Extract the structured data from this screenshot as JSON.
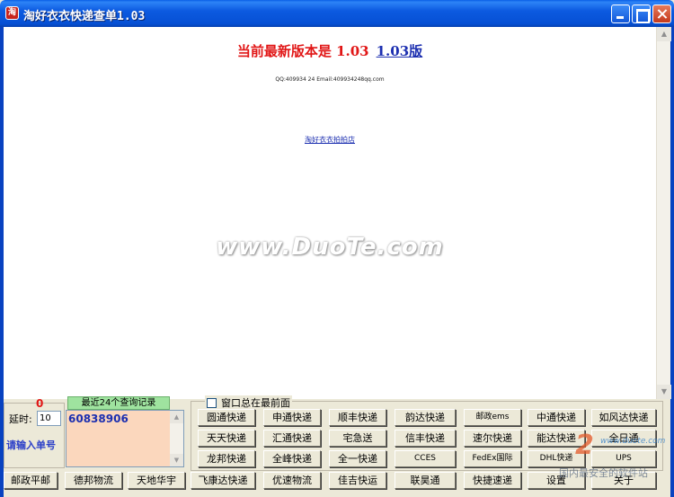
{
  "window": {
    "title": "淘好衣衣快递查单1.03",
    "icon_glyph": "淘"
  },
  "browser": {
    "headline_prefix": "当前最新版本是 1.03",
    "version_link": "1.03版",
    "contact": "QQ:409934 24 Email:409934248qq.com",
    "small_link": "淘好衣衣拍拍店",
    "watermark": "www.DuoTe.com"
  },
  "panel": {
    "count": "0",
    "delay_label": "延时:",
    "delay_value": "10",
    "prompt": "请输入单号",
    "history_tab": "最近24个查询记录",
    "entry_value": "60838906",
    "always_on_top": "窗口总在最前面"
  },
  "buttons": [
    [
      "圆通快递",
      "申通快递",
      "顺丰快递",
      "韵达快递",
      "邮政ems",
      "中通快递",
      "如风达快递"
    ],
    [
      "天天快递",
      "汇通快递",
      "宅急送",
      "信丰快递",
      "速尔快递",
      "能达快递",
      "全日通"
    ],
    [
      "龙邦快递",
      "全峰快递",
      "全一快递",
      "CCES",
      "FedEx国际",
      "DHL快递",
      "UPS"
    ]
  ],
  "bottom_buttons": [
    "邮政平邮",
    "德邦物流",
    "天地华宇",
    "飞康达快递",
    "优速物流",
    "佳吉快运",
    "联昊通",
    "快捷速递",
    "设置",
    "关于"
  ],
  "logo": {
    "digit": "2",
    "line1": "www.duote.com",
    "line2": "国内最安全的软件站"
  },
  "colors": {
    "titlebar": "#0a5fe6",
    "headline_red": "#e11616",
    "link_blue": "#1c2fb0",
    "entry_bg": "#fbd7bd",
    "history_tab": "#9fe39f"
  }
}
